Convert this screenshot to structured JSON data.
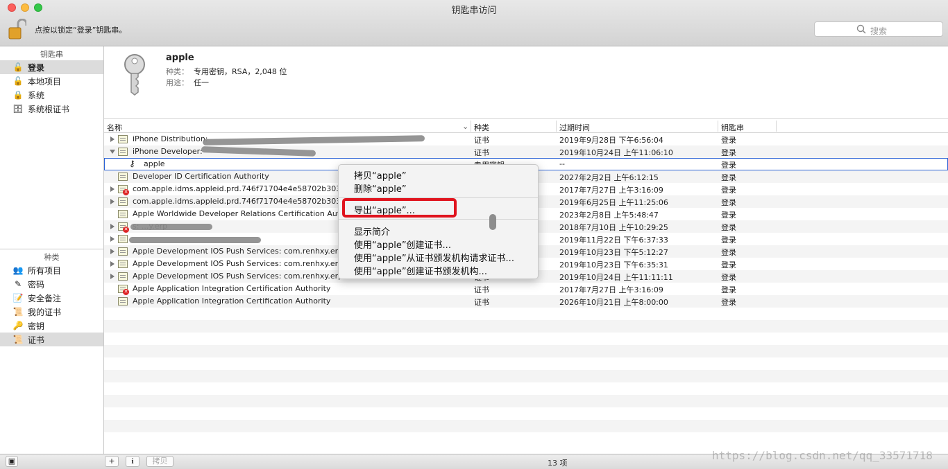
{
  "window": {
    "title": "钥匙串访问"
  },
  "toolbar": {
    "lock_text": "点按以锁定“登录”钥匙串。",
    "search_placeholder": "搜索"
  },
  "sidebar": {
    "keychains_header": "钥匙串",
    "keychains": [
      "登录",
      "本地项目",
      "系统",
      "系统根证书"
    ],
    "category_header": "种类",
    "categories": [
      "所有项目",
      "密码",
      "安全备注",
      "我的证书",
      "密钥",
      "证书"
    ]
  },
  "detail": {
    "name": "apple",
    "kind_label": "种类：",
    "kind_value": "专用密钥，RSA，2,048 位",
    "usage_label": "用途：",
    "usage_value": "任一"
  },
  "table": {
    "headers": [
      "名称",
      "种类",
      "过期时间",
      "钥匙串"
    ],
    "rows": [
      {
        "name": "iPhone Distribution:",
        "kind": "证书",
        "date": "2019年9月28日 下午6:56:04",
        "keychain": "登录"
      },
      {
        "name": "iPhone Developer:",
        "kind": "证书",
        "date": "2019年10月24日 上午11:06:10",
        "keychain": "登录"
      },
      {
        "name": "apple",
        "kind": "专用密钥",
        "date": "--",
        "keychain": "登录"
      },
      {
        "name": "Developer ID Certification Authority",
        "kind": "证书",
        "date": "2027年2月2日 上午6:12:15",
        "keychain": "登录"
      },
      {
        "name": "com.apple.idms.appleid.prd.746f71704e4e58702b30383",
        "kind": "证书",
        "date": "2017年7月27日 上午3:16:09",
        "keychain": "登录"
      },
      {
        "name": "com.apple.idms.appleid.prd.746f71704e4e58702b30383",
        "kind": "证书",
        "date": "2019年6月25日 上午11:25:06",
        "keychain": "登录"
      },
      {
        "name": "Apple Worldwide Developer Relations Certification Authori",
        "kind": "证书",
        "date": "2023年2月8日 上午5:48:47",
        "keychain": "登录"
      },
      {
        "name": "s: ...y.erp",
        "kind": "证书",
        "date": "2018年7月10日 上午10:29:25",
        "keychain": "登录"
      },
      {
        "name": "",
        "kind": "证书",
        "date": "2019年11月22日 下午6:37:33",
        "keychain": "登录"
      },
      {
        "name": "Apple Development IOS Push Services: com.renhxy.erp",
        "kind": "证书",
        "date": "2019年10月23日 下午5:12:27",
        "keychain": "登录"
      },
      {
        "name": "Apple Development IOS Push Services: com.renhxy.erp",
        "kind": "证书",
        "date": "2019年10月23日 下午6:35:31",
        "keychain": "登录"
      },
      {
        "name": "Apple Development IOS Push Services: com.renhxy.erp",
        "kind": "证书",
        "date": "2019年10月24日 上午11:11:11",
        "keychain": "登录"
      },
      {
        "name": "Apple Application Integration Certification Authority",
        "kind": "证书",
        "date": "2017年7月27日 上午3:16:09",
        "keychain": "登录"
      },
      {
        "name": "Apple Application Integration Certification Authority",
        "kind": "证书",
        "date": "2026年10月21日 上午8:00:00",
        "keychain": "登录"
      }
    ]
  },
  "context_menu": {
    "items": [
      "拷贝“apple”",
      "删除“apple”",
      "导出“apple”...",
      "显示简介",
      "使用“apple”创建证书...",
      "使用“apple”从证书颁发机构请求证书...",
      "使用“apple”创建证书颁发机构..."
    ]
  },
  "bottom": {
    "add": "+",
    "info": "i",
    "copy": "拷贝",
    "count": "13 项"
  },
  "watermark": "https://blog.csdn.net/qq_33571718",
  "colors": {
    "highlight": "#e0141e",
    "selection": "#2a62d6"
  }
}
